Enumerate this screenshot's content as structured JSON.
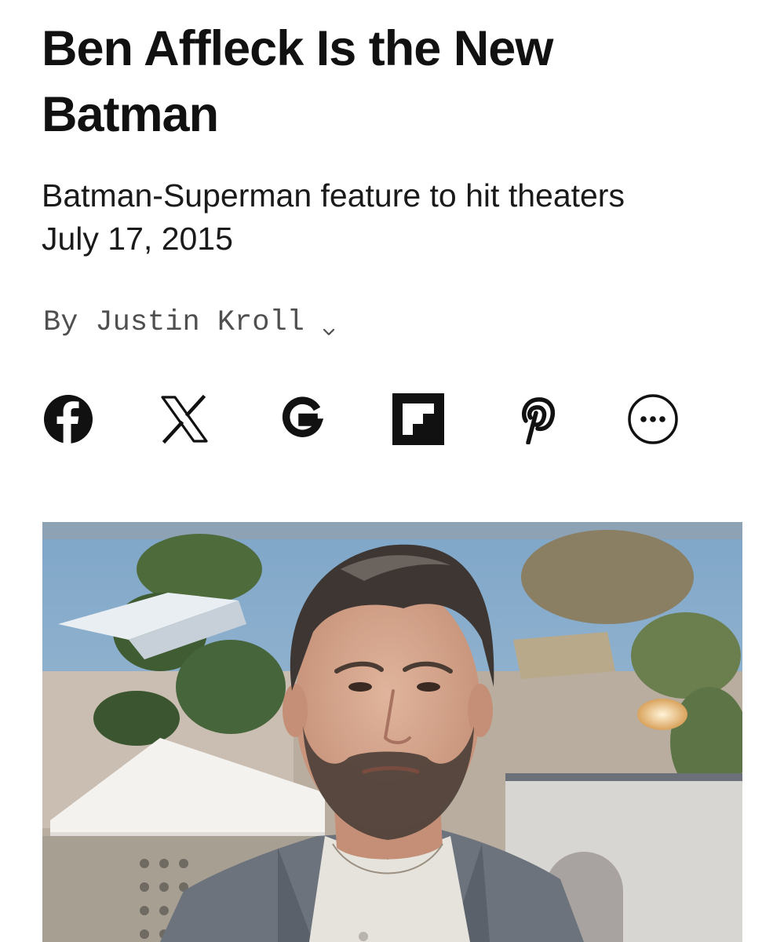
{
  "article": {
    "headline": "Ben Affleck Is the New Batman",
    "dek": "Batman-Superman feature to hit theaters July 17, 2015",
    "byline": {
      "prefix": "By",
      "author": "Justin Kroll",
      "expand_icon": "chevron-down-icon"
    }
  },
  "share": [
    {
      "name": "facebook",
      "icon": "facebook-icon"
    },
    {
      "name": "x",
      "icon": "x-icon"
    },
    {
      "name": "google",
      "icon": "google-icon"
    },
    {
      "name": "flipboard",
      "icon": "flipboard-icon"
    },
    {
      "name": "pinterest",
      "icon": "pinterest-icon"
    },
    {
      "name": "more",
      "icon": "more-icon"
    }
  ],
  "colors": {
    "text": "#111111",
    "byline": "#4f4f4f",
    "background": "#ffffff"
  }
}
